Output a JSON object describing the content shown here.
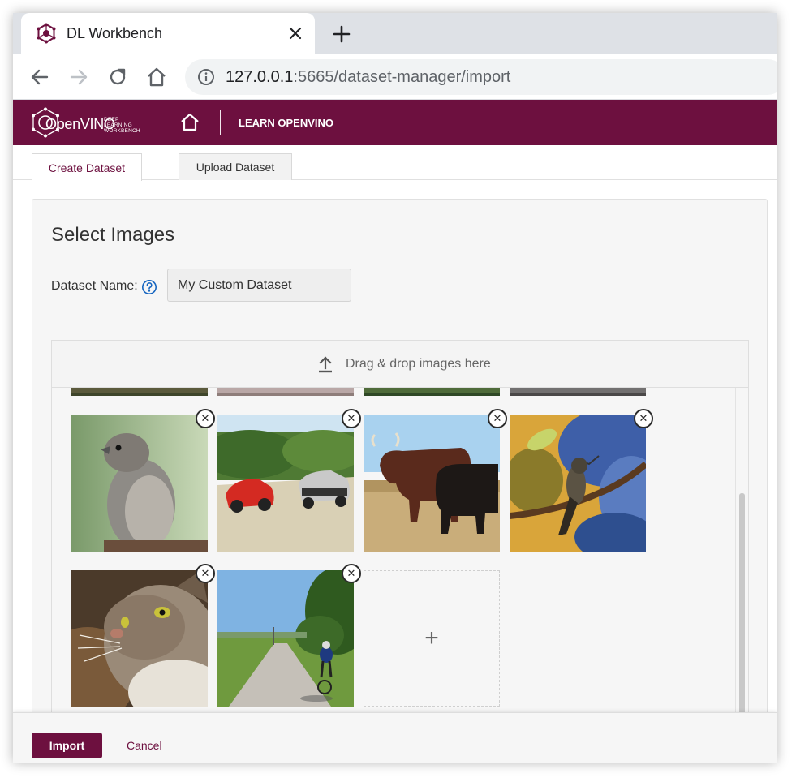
{
  "browser": {
    "tab_title": "DL Workbench",
    "url_host": "127.0.0.1",
    "url_rest": ":5665/dataset-manager/import"
  },
  "app_header": {
    "brand_main": "OpenVINO",
    "brand_sub_line1": "DEEP LEARNING",
    "brand_sub_line2": "WORKBENCH",
    "learn_link": "LEARN OPENVINO",
    "brand_color": "#6d103f"
  },
  "tabs": [
    {
      "label": "Create Dataset",
      "active": true
    },
    {
      "label": "Upload Dataset",
      "active": false
    }
  ],
  "form": {
    "title": "Select Images",
    "dataset_name_label": "Dataset Name:",
    "dataset_name_value": "My Custom Dataset",
    "help_icon": "question-circle-icon"
  },
  "dropzone": {
    "text": "Drag & drop images here",
    "icon": "upload-icon"
  },
  "images": [
    {
      "subject": "sparrow",
      "removable": true
    },
    {
      "subject": "cars",
      "removable": true
    },
    {
      "subject": "cattle",
      "removable": true
    },
    {
      "subject": "hummingbird",
      "removable": true
    },
    {
      "subject": "cat",
      "removable": true
    },
    {
      "subject": "cyclist",
      "removable": true
    }
  ],
  "add_tile": {
    "label": "+"
  },
  "remove_glyph": "✕",
  "footer": {
    "import_label": "Import",
    "cancel_label": "Cancel"
  }
}
